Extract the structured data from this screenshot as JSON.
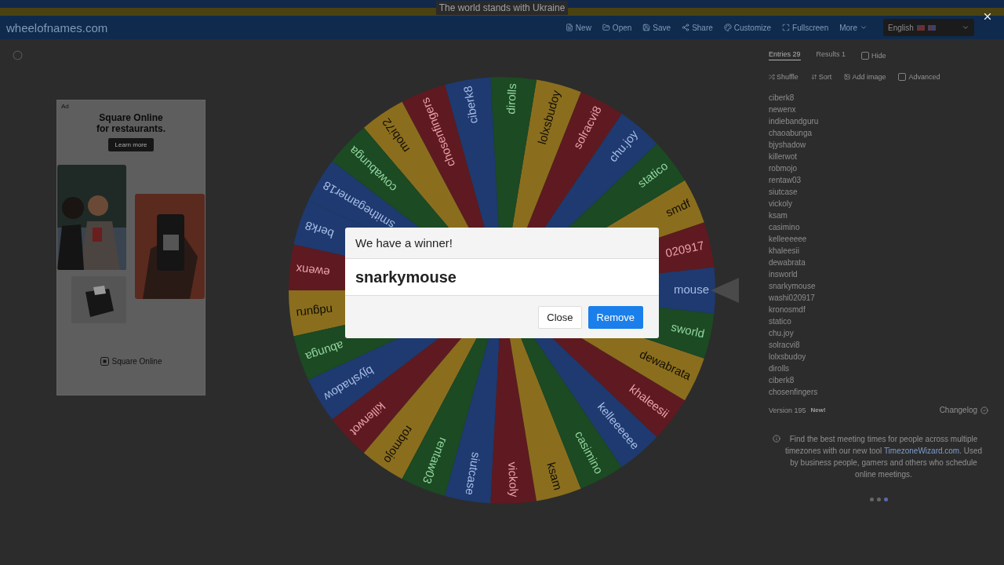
{
  "banner": {
    "text": "The world stands with Ukraine"
  },
  "header": {
    "logo": "wheelofnames.com",
    "menu": [
      {
        "label": "New"
      },
      {
        "label": "Open"
      },
      {
        "label": "Save"
      },
      {
        "label": "Share"
      },
      {
        "label": "Customize"
      },
      {
        "label": "Fullscreen"
      },
      {
        "label": "More"
      }
    ],
    "language": "English"
  },
  "ad": {
    "tag": "Ad",
    "headline": "Square Online",
    "subline": "for restaurants.",
    "button": "Learn more",
    "brand": "Square Online"
  },
  "wheel": {
    "segments": [
      "berk8",
      "ewenx",
      "ndguru",
      "abunga",
      "bjyshadow",
      "killerwot",
      "robmojo",
      "rentaw03",
      "siutcase",
      "vickoly",
      "ksam",
      "casimino",
      "kelleeeeee",
      "khaleesii",
      "dewabrata",
      "sworld",
      "mouse",
      "020917",
      "smdf",
      "statico",
      "chu.joy",
      "solracvi8",
      "lolxsbudoy",
      "dirolls",
      "ciberk8",
      "chosenfingers",
      "mobi72",
      "cowabunga",
      "smithegamer18"
    ]
  },
  "entries_panel": {
    "tabs": [
      {
        "label": "Entries",
        "count": "29",
        "selected": true
      },
      {
        "label": "Results",
        "count": "1",
        "selected": false
      }
    ],
    "hide": {
      "label": "Hide",
      "checked": false
    },
    "tools": [
      "Shuffle",
      "Sort",
      "Add image"
    ],
    "advanced": {
      "label": "Advanced",
      "checked": false
    },
    "entries": [
      "ciberk8",
      "newenx",
      "indiebandguru",
      "chaoabunga",
      "bjyshadow",
      "killerwot",
      "robmojo",
      "rentaw03",
      "siutcase",
      "vickoly",
      "ksam",
      "casimino",
      "kelleeeeee",
      "khaleesii",
      "dewabrata",
      "insworld",
      "snarkymouse",
      "washi020917",
      "kronosmdf",
      "statico",
      "chu.joy",
      "solracvi8",
      "lolxsbudoy",
      "dirolls",
      "ciberk8",
      "chosenfingers"
    ]
  },
  "version": {
    "label": "Version 195",
    "badge": "New!"
  },
  "changelog": "Changelog",
  "notice": {
    "before": "Find the best meeting times for people across multiple timezones with our new tool ",
    "link": "TimezoneWizard.com",
    "after": ". Used by business people, gamers and others who schedule online meetings."
  },
  "carousel": [
    {
      "selected": false
    },
    {
      "selected": false
    },
    {
      "selected": true
    }
  ],
  "dialog": {
    "title": "We have a winner!",
    "winner": "snarkymouse",
    "buttons": [
      {
        "label": "Close",
        "kind": "secondary"
      },
      {
        "label": "Remove",
        "kind": "primary"
      }
    ]
  }
}
